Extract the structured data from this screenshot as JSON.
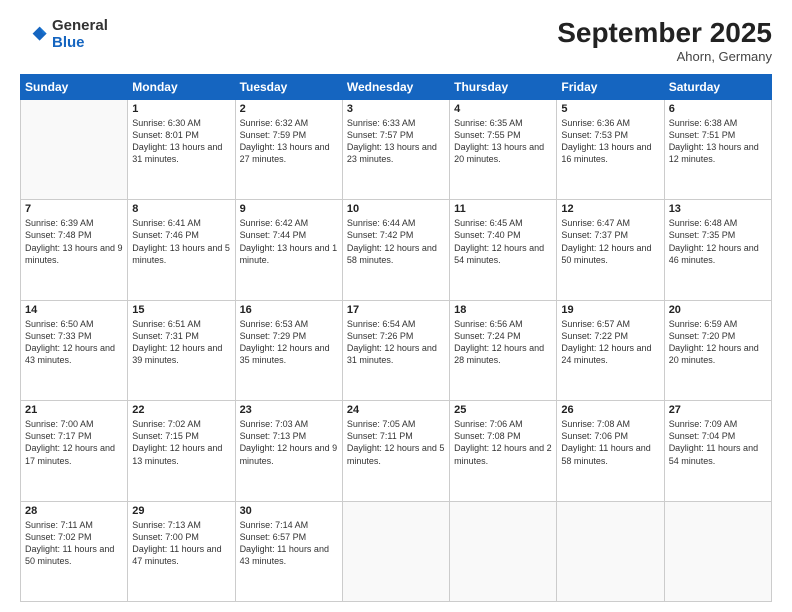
{
  "logo": {
    "general": "General",
    "blue": "Blue"
  },
  "header": {
    "month": "September 2025",
    "location": "Ahorn, Germany"
  },
  "weekdays": [
    "Sunday",
    "Monday",
    "Tuesday",
    "Wednesday",
    "Thursday",
    "Friday",
    "Saturday"
  ],
  "weeks": [
    [
      {
        "day": "",
        "content": ""
      },
      {
        "day": "1",
        "content": "Sunrise: 6:30 AM\nSunset: 8:01 PM\nDaylight: 13 hours and 31 minutes."
      },
      {
        "day": "2",
        "content": "Sunrise: 6:32 AM\nSunset: 7:59 PM\nDaylight: 13 hours and 27 minutes."
      },
      {
        "day": "3",
        "content": "Sunrise: 6:33 AM\nSunset: 7:57 PM\nDaylight: 13 hours and 23 minutes."
      },
      {
        "day": "4",
        "content": "Sunrise: 6:35 AM\nSunset: 7:55 PM\nDaylight: 13 hours and 20 minutes."
      },
      {
        "day": "5",
        "content": "Sunrise: 6:36 AM\nSunset: 7:53 PM\nDaylight: 13 hours and 16 minutes."
      },
      {
        "day": "6",
        "content": "Sunrise: 6:38 AM\nSunset: 7:51 PM\nDaylight: 13 hours and 12 minutes."
      }
    ],
    [
      {
        "day": "7",
        "content": "Sunrise: 6:39 AM\nSunset: 7:48 PM\nDaylight: 13 hours and 9 minutes."
      },
      {
        "day": "8",
        "content": "Sunrise: 6:41 AM\nSunset: 7:46 PM\nDaylight: 13 hours and 5 minutes."
      },
      {
        "day": "9",
        "content": "Sunrise: 6:42 AM\nSunset: 7:44 PM\nDaylight: 13 hours and 1 minute."
      },
      {
        "day": "10",
        "content": "Sunrise: 6:44 AM\nSunset: 7:42 PM\nDaylight: 12 hours and 58 minutes."
      },
      {
        "day": "11",
        "content": "Sunrise: 6:45 AM\nSunset: 7:40 PM\nDaylight: 12 hours and 54 minutes."
      },
      {
        "day": "12",
        "content": "Sunrise: 6:47 AM\nSunset: 7:37 PM\nDaylight: 12 hours and 50 minutes."
      },
      {
        "day": "13",
        "content": "Sunrise: 6:48 AM\nSunset: 7:35 PM\nDaylight: 12 hours and 46 minutes."
      }
    ],
    [
      {
        "day": "14",
        "content": "Sunrise: 6:50 AM\nSunset: 7:33 PM\nDaylight: 12 hours and 43 minutes."
      },
      {
        "day": "15",
        "content": "Sunrise: 6:51 AM\nSunset: 7:31 PM\nDaylight: 12 hours and 39 minutes."
      },
      {
        "day": "16",
        "content": "Sunrise: 6:53 AM\nSunset: 7:29 PM\nDaylight: 12 hours and 35 minutes."
      },
      {
        "day": "17",
        "content": "Sunrise: 6:54 AM\nSunset: 7:26 PM\nDaylight: 12 hours and 31 minutes."
      },
      {
        "day": "18",
        "content": "Sunrise: 6:56 AM\nSunset: 7:24 PM\nDaylight: 12 hours and 28 minutes."
      },
      {
        "day": "19",
        "content": "Sunrise: 6:57 AM\nSunset: 7:22 PM\nDaylight: 12 hours and 24 minutes."
      },
      {
        "day": "20",
        "content": "Sunrise: 6:59 AM\nSunset: 7:20 PM\nDaylight: 12 hours and 20 minutes."
      }
    ],
    [
      {
        "day": "21",
        "content": "Sunrise: 7:00 AM\nSunset: 7:17 PM\nDaylight: 12 hours and 17 minutes."
      },
      {
        "day": "22",
        "content": "Sunrise: 7:02 AM\nSunset: 7:15 PM\nDaylight: 12 hours and 13 minutes."
      },
      {
        "day": "23",
        "content": "Sunrise: 7:03 AM\nSunset: 7:13 PM\nDaylight: 12 hours and 9 minutes."
      },
      {
        "day": "24",
        "content": "Sunrise: 7:05 AM\nSunset: 7:11 PM\nDaylight: 12 hours and 5 minutes."
      },
      {
        "day": "25",
        "content": "Sunrise: 7:06 AM\nSunset: 7:08 PM\nDaylight: 12 hours and 2 minutes."
      },
      {
        "day": "26",
        "content": "Sunrise: 7:08 AM\nSunset: 7:06 PM\nDaylight: 11 hours and 58 minutes."
      },
      {
        "day": "27",
        "content": "Sunrise: 7:09 AM\nSunset: 7:04 PM\nDaylight: 11 hours and 54 minutes."
      }
    ],
    [
      {
        "day": "28",
        "content": "Sunrise: 7:11 AM\nSunset: 7:02 PM\nDaylight: 11 hours and 50 minutes."
      },
      {
        "day": "29",
        "content": "Sunrise: 7:13 AM\nSunset: 7:00 PM\nDaylight: 11 hours and 47 minutes."
      },
      {
        "day": "30",
        "content": "Sunrise: 7:14 AM\nSunset: 6:57 PM\nDaylight: 11 hours and 43 minutes."
      },
      {
        "day": "",
        "content": ""
      },
      {
        "day": "",
        "content": ""
      },
      {
        "day": "",
        "content": ""
      },
      {
        "day": "",
        "content": ""
      }
    ]
  ]
}
